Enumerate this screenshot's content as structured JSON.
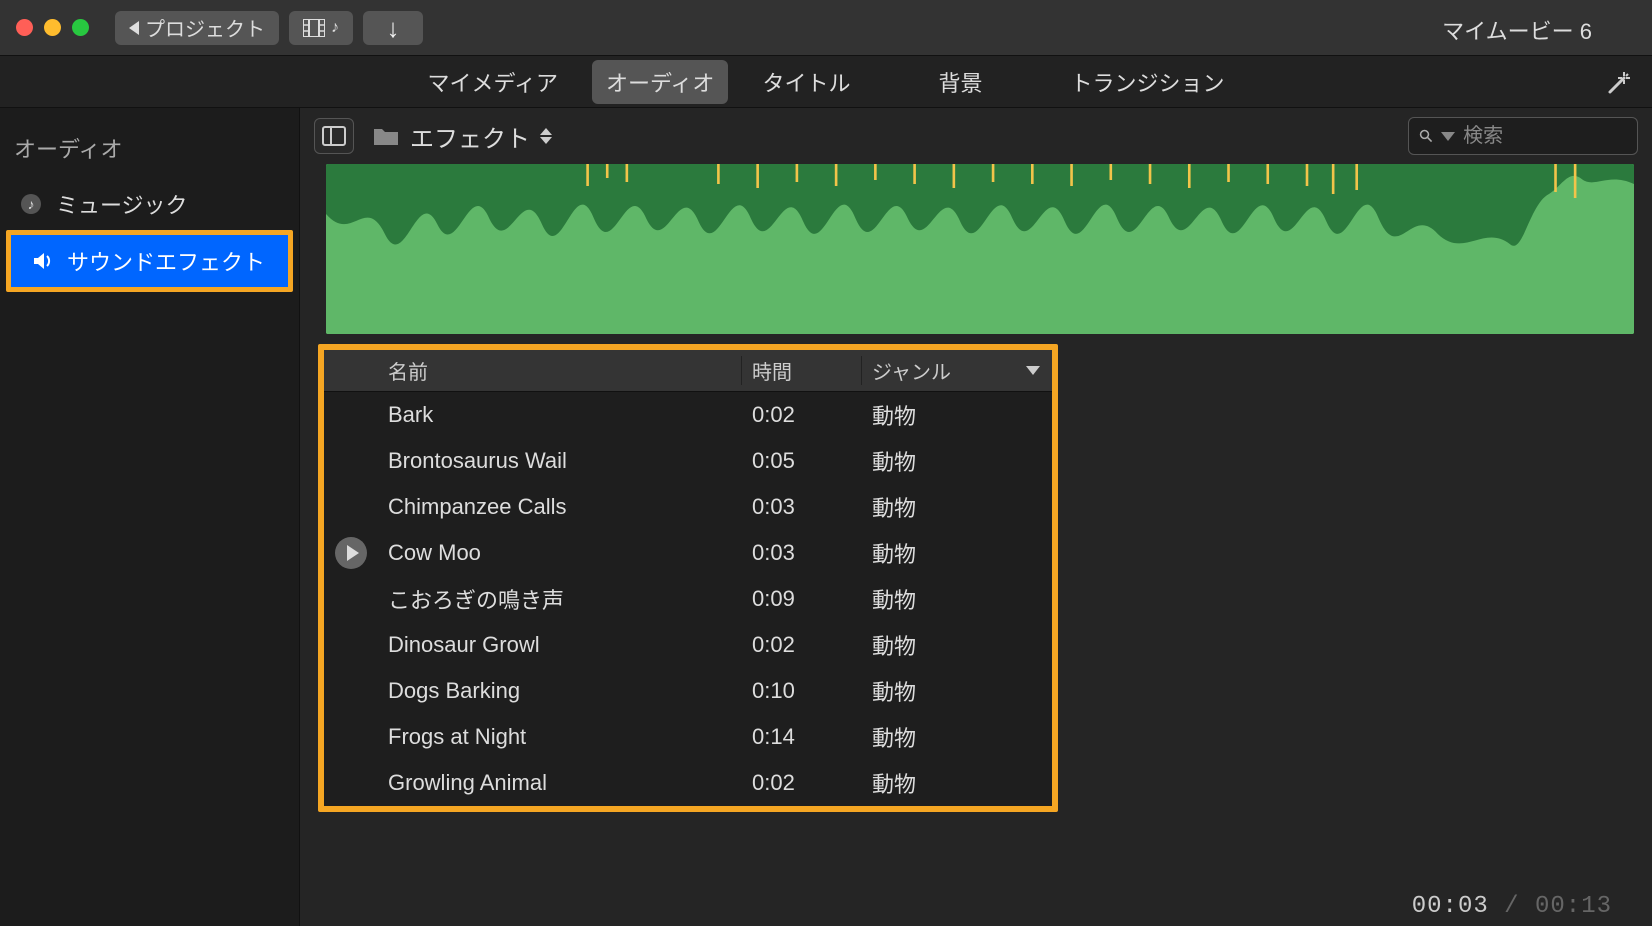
{
  "titlebar": {
    "back_label": "プロジェクト",
    "project_title": "マイムービー 6"
  },
  "tabs": {
    "my_media": "マイメディア",
    "audio": "オーディオ",
    "titles": "タイトル",
    "backgrounds": "背景",
    "transitions": "トランジション"
  },
  "sidebar": {
    "heading": "オーディオ",
    "items": [
      {
        "label": "ミュージック",
        "icon": "music-note-icon",
        "selected": false
      },
      {
        "label": "サウンドエフェクト",
        "icon": "speaker-icon",
        "selected": true
      }
    ]
  },
  "browser": {
    "folder_label": "エフェクト",
    "search_placeholder": "検索"
  },
  "table": {
    "headers": {
      "name": "名前",
      "time": "時間",
      "genre": "ジャンル"
    },
    "rows": [
      {
        "name": "Bark",
        "time": "0:02",
        "genre": "動物",
        "playing": false
      },
      {
        "name": "Brontosaurus Wail",
        "time": "0:05",
        "genre": "動物",
        "playing": false
      },
      {
        "name": "Chimpanzee Calls",
        "time": "0:03",
        "genre": "動物",
        "playing": false
      },
      {
        "name": "Cow Moo",
        "time": "0:03",
        "genre": "動物",
        "playing": true
      },
      {
        "name": "こおろぎの鳴き声",
        "time": "0:09",
        "genre": "動物",
        "playing": false
      },
      {
        "name": "Dinosaur Growl",
        "time": "0:02",
        "genre": "動物",
        "playing": false
      },
      {
        "name": "Dogs Barking",
        "time": "0:10",
        "genre": "動物",
        "playing": false
      },
      {
        "name": "Frogs at Night",
        "time": "0:14",
        "genre": "動物",
        "playing": false
      },
      {
        "name": "Growling Animal",
        "time": "0:02",
        "genre": "動物",
        "playing": false
      }
    ]
  },
  "footer": {
    "current_time": "00:03",
    "sep": "  /  ",
    "total_time": "00:13"
  }
}
